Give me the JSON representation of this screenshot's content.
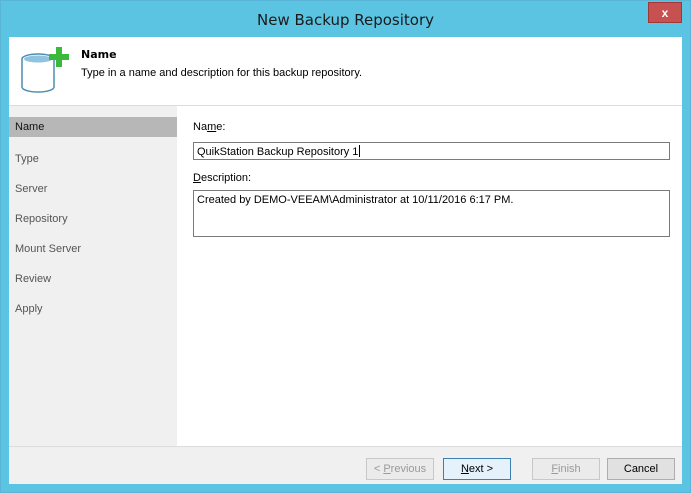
{
  "window": {
    "title": "New Backup Repository",
    "close_label": "x"
  },
  "header": {
    "title": "Name",
    "description": "Type in a name and description for this backup repository.",
    "icon": "database-add-icon"
  },
  "sidebar": {
    "items": [
      {
        "label": "Name",
        "active": true
      },
      {
        "label": "Type",
        "active": false
      },
      {
        "label": "Server",
        "active": false
      },
      {
        "label": "Repository",
        "active": false
      },
      {
        "label": "Mount Server",
        "active": false
      },
      {
        "label": "Review",
        "active": false
      },
      {
        "label": "Apply",
        "active": false
      }
    ]
  },
  "form": {
    "name_label_pre": "Na",
    "name_label_u": "m",
    "name_label_post": "e:",
    "name_value": "QuikStation Backup Repository 1",
    "description_label_u": "D",
    "description_label_post": "escription:",
    "description_value": "Created by DEMO-VEEAM\\Administrator at 10/11/2016 6:17 PM."
  },
  "footer": {
    "previous_label_pre": "< ",
    "previous_label_u": "P",
    "previous_label_post": "revious",
    "next_label_u": "N",
    "next_label_post": "ext >",
    "finish_label_u": "F",
    "finish_label_post": "inish",
    "cancel_label": "Cancel"
  },
  "colors": {
    "titlebar": "#5bc4e3",
    "close_button": "#c75050",
    "sidebar_active": "#b7b7b7",
    "icon_plus": "#3cb93c",
    "icon_db": "#6aa8c9"
  }
}
